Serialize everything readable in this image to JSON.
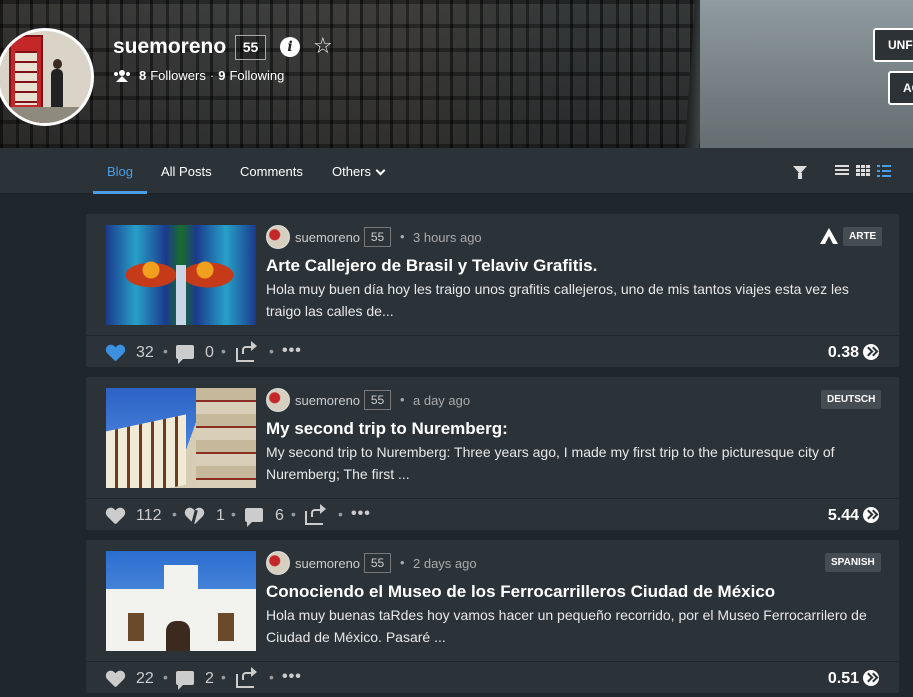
{
  "profile": {
    "username": "suemoreno",
    "reputation": "55",
    "followers_count": "8",
    "followers_label": "Followers",
    "following_count": "9",
    "following_label": "Following",
    "unfollow_label": "UNFOLLOW",
    "second_button_label": "ACTIONS"
  },
  "nav": {
    "tabs": [
      {
        "label": "Blog"
      },
      {
        "label": "All Posts"
      },
      {
        "label": "Comments"
      },
      {
        "label": "Others"
      }
    ]
  },
  "posts": [
    {
      "author": "suemoreno",
      "reputation": "55",
      "time": "3 hours ago",
      "tag": "ARTE",
      "title": "Arte Callejero de Brasil y Telaviv Grafitis.",
      "excerpt": "Hola muy buen día hoy les traigo unos grafitis callejeros, uno de mis tantos viajes esta vez les traigo las calles de...",
      "votes": "32",
      "comments": "0",
      "payout": "0.38"
    },
    {
      "author": "suemoreno",
      "reputation": "55",
      "time": "a day ago",
      "tag": "DEUTSCH",
      "title": "My second trip to Nuremberg:",
      "excerpt": "My second trip to Nuremberg: Three years ago, I made my first trip to the picturesque city of Nuremberg; The first ...",
      "votes": "112",
      "downvotes": "1",
      "comments": "6",
      "payout": "5.44"
    },
    {
      "author": "suemoreno",
      "reputation": "55",
      "time": "2 days ago",
      "tag": "SPANISH",
      "title": "Conociendo el Museo de los Ferrocarrilleros Ciudad de México",
      "excerpt": "Hola muy buenas taRdes hoy vamos hacer un pequeño recorrido, por el Museo Ferrocarrilero de Ciudad de México. Pasaré ...",
      "votes": "22",
      "comments": "2",
      "payout": "0.51"
    }
  ],
  "colors": {
    "accent": "#4a9ee6",
    "upvote_active": "#3d8fe0",
    "background": "#1f262c",
    "card": "#2b3338"
  }
}
